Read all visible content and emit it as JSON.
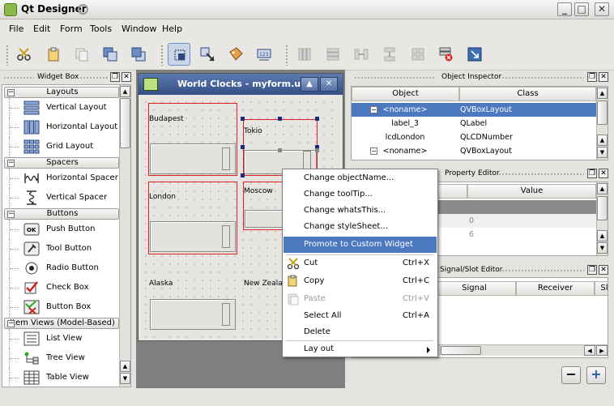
{
  "app": {
    "title": "Qt Designer"
  },
  "window_buttons": {
    "minimize": "_",
    "maximize": "□",
    "close": "✕"
  },
  "menubar": [
    "File",
    "Edit",
    "Form",
    "Tools",
    "Window",
    "Help"
  ],
  "toolbar": {
    "icons": [
      "scissors-icon",
      "paste-icon",
      "copy-icon",
      "window-icon",
      "window-icon",
      "edit-widgets-icon",
      "edit-signals-icon",
      "edit-buddies-icon",
      "edit-tab-order-icon",
      "layout-horizontal-icon",
      "layout-vertical-icon",
      "layout-splitter-h-icon",
      "layout-splitter-v-icon",
      "layout-grid-icon",
      "break-layout-icon",
      "adjust-size-icon"
    ]
  },
  "widget_box": {
    "title": "Widget Box",
    "categories": [
      {
        "label": "Layouts",
        "items": [
          "Vertical Layout",
          "Horizontal Layout",
          "Grid Layout"
        ]
      },
      {
        "label": "Spacers",
        "items": [
          "Horizontal Spacer",
          "Vertical Spacer"
        ]
      },
      {
        "label": "Buttons",
        "items": [
          "Push Button",
          "Tool Button",
          "Radio Button",
          "Check Box",
          "Button Box"
        ]
      },
      {
        "label": "Item Views (Model-Based)",
        "items": [
          "List View",
          "Tree View",
          "Table View"
        ]
      }
    ]
  },
  "form_window": {
    "title": "World Clocks - myform.ui*",
    "min_glyph": "▲",
    "close_glyph": "✕",
    "labels": {
      "budapest": "Budapest",
      "tokio": "Tokio",
      "london": "London",
      "moscow": "Moscow",
      "alaska": "Alaska",
      "new_zealand": "New Zealan"
    }
  },
  "object_inspector": {
    "title": "Object Inspector",
    "columns": [
      "Object",
      "Class"
    ],
    "rows": [
      {
        "object": "<noname>",
        "class": "QVBoxLayout",
        "selected": true,
        "toggle": "−"
      },
      {
        "object": "label_3",
        "class": "QLabel"
      },
      {
        "object": "lcdLondon",
        "class": "QLCDNumber"
      },
      {
        "object": "<noname>",
        "class": "QVBoxLayout",
        "toggle": "−"
      }
    ]
  },
  "property_editor": {
    "title": "Property Editor",
    "columns": [
      "Value"
    ],
    "values": [
      "0",
      "6"
    ]
  },
  "signal_slot_editor": {
    "title": "Signal/Slot Editor",
    "columns": [
      "Signal",
      "Receiver",
      "Slo"
    ],
    "remove_glyph": "−",
    "add_glyph": "+"
  },
  "context_menu": {
    "items": [
      {
        "label": "Change objectName..."
      },
      {
        "label": "Change toolTip..."
      },
      {
        "label": "Change whatsThis..."
      },
      {
        "label": "Change styleSheet..."
      },
      {
        "label": "Promote to Custom Widget",
        "highlighted": true
      },
      {
        "label": "Cut",
        "shortcut": "Ctrl+X",
        "icon": "scissors-icon"
      },
      {
        "label": "Copy",
        "shortcut": "Ctrl+C",
        "icon": "copy-icon"
      },
      {
        "label": "Paste",
        "shortcut": "Ctrl+V",
        "icon": "paste-icon",
        "disabled": true
      },
      {
        "label": "Select All",
        "shortcut": "Ctrl+A"
      },
      {
        "label": "Delete"
      },
      {
        "label": "Lay out",
        "submenu": true
      }
    ]
  },
  "colors": {
    "selection": "#4c78c0",
    "form_title": "#334f86",
    "layout_border": "#dd2222"
  }
}
